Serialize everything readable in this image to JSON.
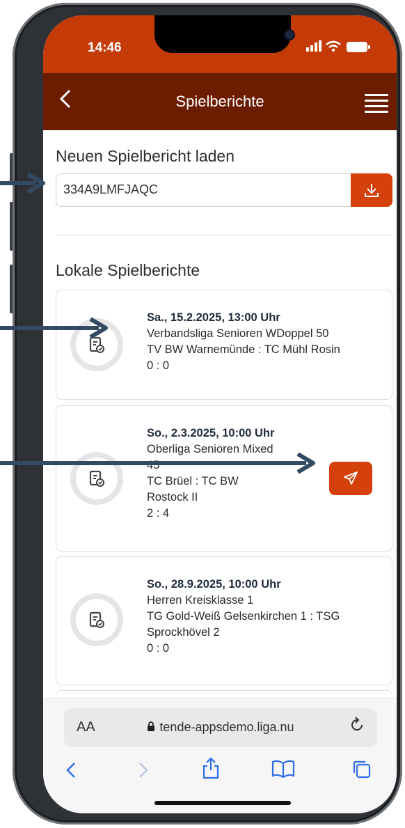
{
  "status": {
    "time": "14:46"
  },
  "header": {
    "title": "Spielberichte"
  },
  "load": {
    "heading": "Neuen Spielbericht laden",
    "code_value": "334A9LMFJAQC"
  },
  "local": {
    "heading": "Lokale Spielberichte",
    "reports": [
      {
        "date": "Sa., 15.2.2025, 13:00 Uhr",
        "lines": [
          "Verbandsliga Senioren WDoppel 50",
          "TV BW Warnemünde : TC Mühl Rosin",
          "0 : 0"
        ]
      },
      {
        "date": "So., 2.3.2025, 10:00 Uhr",
        "lines": [
          "Oberliga Senioren Mixed",
          "45",
          "TC Brüel : TC BW",
          "Rostock II",
          "2 : 4"
        ]
      },
      {
        "date": "So., 28.9.2025, 10:00 Uhr",
        "lines": [
          "Herren Kreisklasse 1",
          "TG Gold-Weiß Gelsenkirchen 1 : TSG",
          "Sprockhövel 2",
          "0 : 0"
        ]
      }
    ]
  },
  "browser": {
    "aa_label": "AA",
    "url": "tende-appsdemo.liga.nu"
  },
  "colors": {
    "accent": "#d4410b",
    "navbar": "#6c1d00",
    "statusbar": "#c53b07",
    "arrow": "#344a63"
  }
}
